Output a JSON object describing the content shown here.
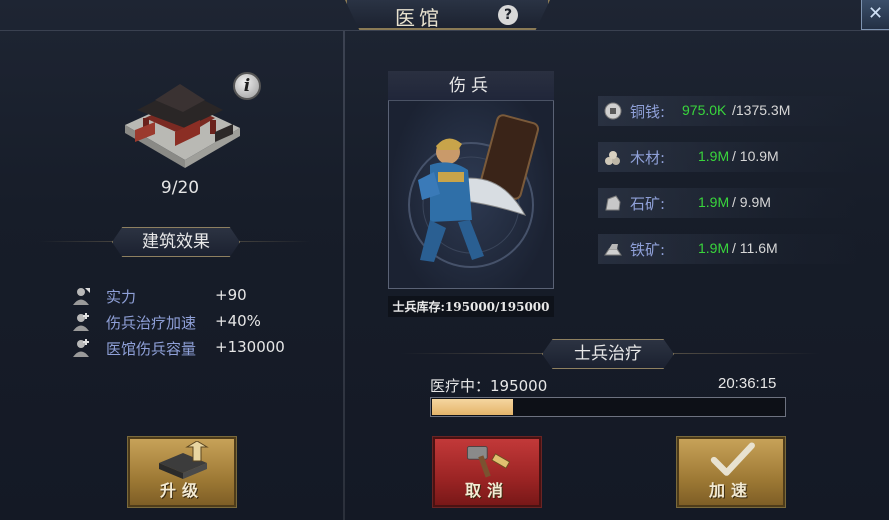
{
  "window": {
    "title": "医馆"
  },
  "building": {
    "level_text": "9/20",
    "effects_header": "建筑效果",
    "effects": [
      {
        "label": "实力",
        "value": "+90"
      },
      {
        "label": "伤兵治疗加速",
        "value": "+40%"
      },
      {
        "label": "医馆伤兵容量",
        "value": "+130000"
      }
    ]
  },
  "unit": {
    "title": "伤兵",
    "stock": "士兵库存:195000/195000"
  },
  "resources": [
    {
      "name": "铜钱:",
      "current": "975.0K",
      "max": "/1375.3M",
      "icon": "coin-icon"
    },
    {
      "name": "木材:",
      "current": "1.9M",
      "max": "/ 10.9M",
      "icon": "wood-icon"
    },
    {
      "name": "石矿:",
      "current": "1.9M",
      "max": "/ 9.9M",
      "icon": "stone-icon"
    },
    {
      "name": "铁矿:",
      "current": "1.9M",
      "max": "/ 11.6M",
      "icon": "iron-icon"
    }
  ],
  "healing": {
    "header": "士兵治疗",
    "status": "医疗中：195000",
    "time_left": "20:36:15",
    "progress_fraction": 0.23
  },
  "buttons": {
    "upgrade": "升级",
    "cancel": "取消",
    "speedup": "加速"
  },
  "colors": {
    "resource_current": "#39d53c",
    "label_blue": "#8fa0d8",
    "progress_fill": "#e4b46a"
  }
}
